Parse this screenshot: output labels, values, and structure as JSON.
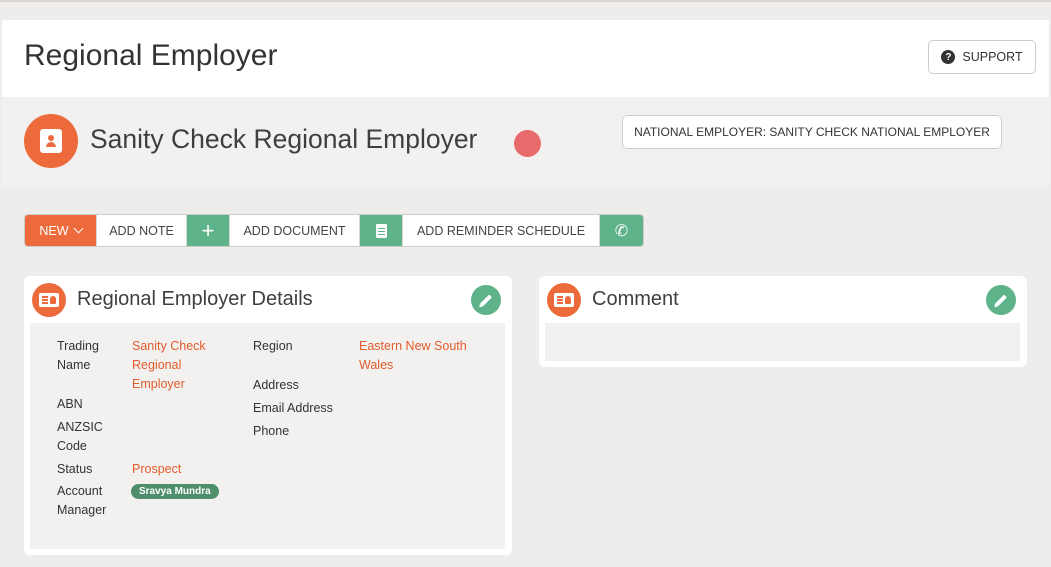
{
  "header": {
    "title": "Regional Employer",
    "support_label": "SUPPORT",
    "support_icon": "question-circle-icon"
  },
  "entity": {
    "name": "Sanity Check Regional Employer",
    "status_color": "#e86a6a",
    "national_employer_label": "NATIONAL EMPLOYER: SANITY CHECK NATIONAL EMPLOYER"
  },
  "toolbar": {
    "new_label": "NEW",
    "add_note_label": "ADD NOTE",
    "add_document_label": "ADD DOCUMENT",
    "add_reminder_label": "ADD REMINDER SCHEDULE",
    "plus_glyph": "+",
    "phone_glyph": "✆"
  },
  "details": {
    "title": "Regional Employer Details",
    "labels": {
      "trading_name_1": "Trading",
      "trading_name_2": "Name",
      "abn": "ABN",
      "anzsic_1": "ANZSIC",
      "anzsic_2": "Code",
      "status": "Status",
      "account_manager_1": "Account",
      "account_manager_2": "Manager",
      "region": "Region",
      "address": "Address",
      "email": "Email Address",
      "phone": "Phone"
    },
    "values": {
      "trading_name_1": "Sanity Check",
      "trading_name_2": "Regional",
      "trading_name_3": "Employer",
      "status": "Prospect",
      "account_manager": "Sravya Mundra",
      "region_1": "Eastern New South",
      "region_2": "Wales"
    }
  },
  "comment": {
    "title": "Comment"
  },
  "colors": {
    "accent": "#ec6a3c",
    "green": "#5fb38b",
    "link": "#e05c2c"
  }
}
